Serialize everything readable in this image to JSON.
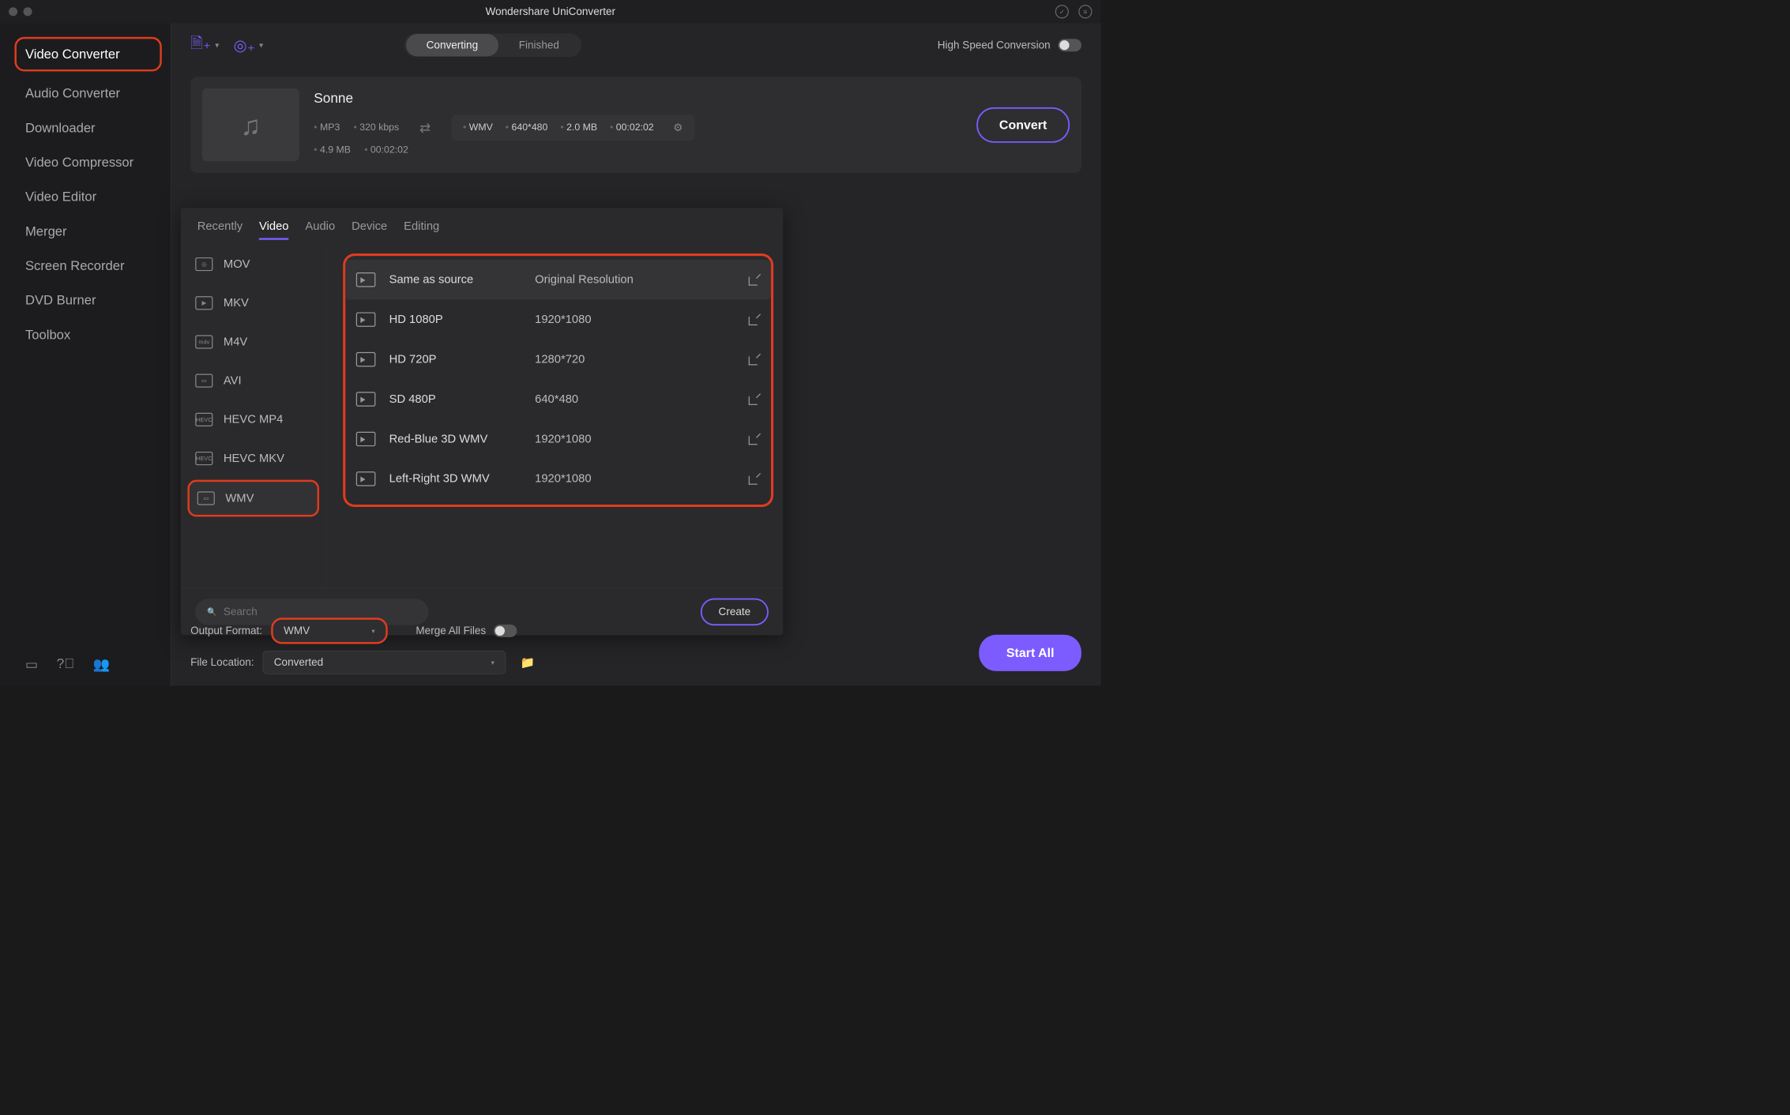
{
  "app_title": "Wondershare UniConverter",
  "sidebar": {
    "items": [
      "Video Converter",
      "Audio Converter",
      "Downloader",
      "Video Compressor",
      "Video Editor",
      "Merger",
      "Screen Recorder",
      "DVD Burner",
      "Toolbox"
    ],
    "active_index": 0
  },
  "segmented": {
    "converting": "Converting",
    "finished": "Finished"
  },
  "high_speed_label": "High Speed Conversion",
  "item": {
    "title": "Sonne",
    "src_meta": [
      "MP3",
      "320 kbps",
      "4.9 MB",
      "00:02:02"
    ],
    "dst_meta": [
      "WMV",
      "640*480",
      "2.0 MB",
      "00:02:02"
    ],
    "convert_btn": "Convert"
  },
  "format_popup": {
    "tabs": [
      "Recently",
      "Video",
      "Audio",
      "Device",
      "Editing"
    ],
    "active_tab": 1,
    "formats": [
      "MOV",
      "MKV",
      "M4V",
      "AVI",
      "HEVC MP4",
      "HEVC MKV",
      "WMV"
    ],
    "selected_format": "WMV",
    "resolutions": [
      {
        "name": "Same as source",
        "dim": "Original Resolution"
      },
      {
        "name": "HD 1080P",
        "dim": "1920*1080"
      },
      {
        "name": "HD 720P",
        "dim": "1280*720"
      },
      {
        "name": "SD 480P",
        "dim": "640*480"
      },
      {
        "name": "Red-Blue 3D WMV",
        "dim": "1920*1080"
      },
      {
        "name": "Left-Right 3D WMV",
        "dim": "1920*1080"
      }
    ],
    "search_placeholder": "Search",
    "create_btn": "Create"
  },
  "footer": {
    "output_format_label": "Output Format:",
    "output_format_value": "WMV",
    "merge_label": "Merge All Files",
    "file_location_label": "File Location:",
    "file_location_value": "Converted",
    "start_all": "Start All"
  }
}
